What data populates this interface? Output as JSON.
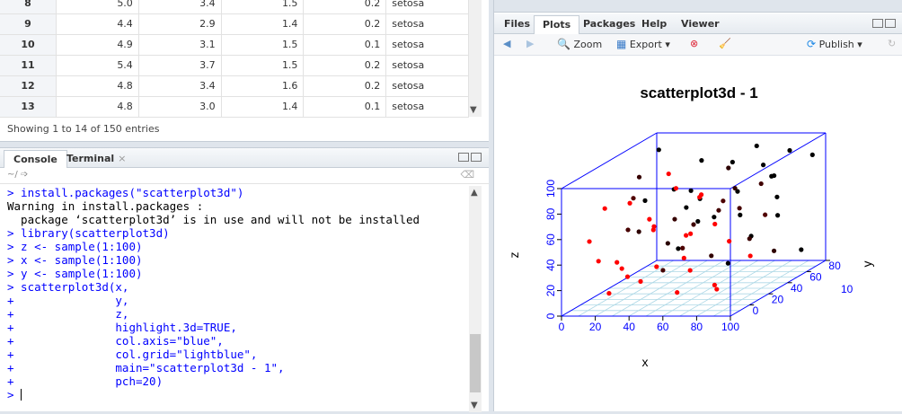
{
  "data_table": {
    "partial_row": [
      "8",
      "5.0",
      "3.4",
      "1.5",
      "0.2",
      "setosa"
    ],
    "rows": [
      [
        "9",
        "4.4",
        "2.9",
        "1.4",
        "0.2",
        "setosa"
      ],
      [
        "10",
        "4.9",
        "3.1",
        "1.5",
        "0.1",
        "setosa"
      ],
      [
        "11",
        "5.4",
        "3.7",
        "1.5",
        "0.2",
        "setosa"
      ],
      [
        "12",
        "4.8",
        "3.4",
        "1.6",
        "0.2",
        "setosa"
      ],
      [
        "13",
        "4.8",
        "3.0",
        "1.4",
        "0.1",
        "setosa"
      ]
    ],
    "entries_text": "Showing 1 to 14 of 150 entries"
  },
  "console": {
    "tabs": [
      {
        "label": "Console"
      },
      {
        "label": "Terminal"
      }
    ],
    "path": "~/",
    "lines": [
      {
        "kind": "in",
        "text": "> install.packages(\"scatterplot3d\")"
      },
      {
        "kind": "out",
        "text": "Warning in install.packages :"
      },
      {
        "kind": "out",
        "text": "  package ‘scatterplot3d’ is in use and will not be installed"
      },
      {
        "kind": "in",
        "text": "> library(scatterplot3d)"
      },
      {
        "kind": "in",
        "text": "> z <- sample(1:100)"
      },
      {
        "kind": "in",
        "text": "> x <- sample(1:100)"
      },
      {
        "kind": "in",
        "text": "> y <- sample(1:100)"
      },
      {
        "kind": "in",
        "text": "> scatterplot3d(x,"
      },
      {
        "kind": "in",
        "text": "+               y,"
      },
      {
        "kind": "in",
        "text": "+               z,"
      },
      {
        "kind": "in",
        "text": "+               highlight.3d=TRUE,"
      },
      {
        "kind": "in",
        "text": "+               col.axis=\"blue\","
      },
      {
        "kind": "in",
        "text": "+               col.grid=\"lightblue\","
      },
      {
        "kind": "in",
        "text": "+               main=\"scatterplot3d - 1\","
      },
      {
        "kind": "in",
        "text": "+               pch=20)"
      }
    ],
    "prompt": ">"
  },
  "right_pane": {
    "tabs": [
      {
        "label": "Files"
      },
      {
        "label": "Plots"
      },
      {
        "label": "Packages"
      },
      {
        "label": "Help"
      },
      {
        "label": "Viewer"
      }
    ],
    "toolbar": {
      "zoom": "Zoom",
      "export": "Export",
      "publish": "Publish"
    }
  },
  "chart_data": {
    "type": "scatter",
    "title": "scatterplot3d - 1",
    "xlabel": "x",
    "ylabel": "y",
    "zlabel": "z",
    "xlim": [
      0,
      100
    ],
    "ylim": [
      0,
      100
    ],
    "zlim": [
      0,
      100
    ],
    "x_ticks": [
      "0",
      "20",
      "40",
      "60",
      "80",
      "100"
    ],
    "y_ticks": [
      "0",
      "20",
      "40",
      "60",
      "80",
      "100"
    ],
    "z_ticks": [
      "0",
      "20",
      "40",
      "60",
      "80",
      "100"
    ],
    "colors": {
      "axis": "#0000ff",
      "grid": "#add8e6",
      "near_point": "#ff0000",
      "far_point": "#000000"
    },
    "grid": true,
    "points": [
      [
        12,
        8,
        55
      ],
      [
        45,
        20,
        30
      ],
      [
        60,
        15,
        12
      ],
      [
        75,
        30,
        8
      ],
      [
        30,
        5,
        40
      ],
      [
        85,
        10,
        20
      ],
      [
        20,
        40,
        75
      ],
      [
        50,
        50,
        50
      ],
      [
        65,
        60,
        90
      ],
      [
        90,
        80,
        95
      ],
      [
        10,
        70,
        60
      ],
      [
        35,
        85,
        85
      ],
      [
        55,
        90,
        40
      ],
      [
        80,
        45,
        65
      ],
      [
        25,
        25,
        20
      ],
      [
        70,
        75,
        30
      ],
      [
        95,
        95,
        85
      ],
      [
        40,
        65,
        70
      ],
      [
        15,
        55,
        85
      ],
      [
        5,
        30,
        30
      ],
      [
        88,
        20,
        50
      ],
      [
        62,
        35,
        78
      ],
      [
        48,
        12,
        65
      ],
      [
        33,
        48,
        15
      ],
      [
        78,
        88,
        55
      ],
      [
        22,
        92,
        45
      ],
      [
        58,
        72,
        10
      ],
      [
        92,
        60,
        25
      ],
      [
        42,
        38,
        95
      ],
      [
        68,
        8,
        42
      ],
      [
        18,
        18,
        10
      ],
      [
        82,
        52,
        38
      ],
      [
        52,
        28,
        88
      ],
      [
        28,
        62,
        30
      ],
      [
        72,
        42,
        72
      ],
      [
        38,
        78,
        58
      ],
      [
        98,
        40,
        62
      ],
      [
        8,
        88,
        92
      ],
      [
        46,
        98,
        78
      ],
      [
        64,
        22,
        55
      ],
      [
        86,
        68,
        80
      ],
      [
        14,
        45,
        48
      ],
      [
        56,
        58,
        22
      ],
      [
        74,
        92,
        70
      ],
      [
        32,
        15,
        82
      ],
      [
        96,
        28,
        35
      ],
      [
        24,
        80,
        18
      ],
      [
        66,
        48,
        62
      ],
      [
        44,
        5,
        25
      ],
      [
        84,
        78,
        45
      ],
      [
        54,
        35,
        48
      ],
      [
        36,
        55,
        52
      ],
      [
        76,
        12,
        90
      ],
      [
        26,
        72,
        68
      ],
      [
        94,
        85,
        15
      ],
      [
        16,
        35,
        22
      ],
      [
        62,
        95,
        92
      ],
      [
        48,
        42,
        35
      ],
      [
        70,
        58,
        75
      ],
      [
        30,
        90,
        35
      ],
      [
        88,
        5,
        70
      ],
      [
        42,
        22,
        58
      ],
      [
        58,
        82,
        62
      ],
      [
        20,
        10,
        80
      ],
      [
        80,
        70,
        88
      ],
      [
        34,
        32,
        62
      ],
      [
        52,
        68,
        48
      ],
      [
        66,
        18,
        28
      ],
      [
        12,
        60,
        40
      ],
      [
        90,
        50,
        82
      ]
    ]
  }
}
